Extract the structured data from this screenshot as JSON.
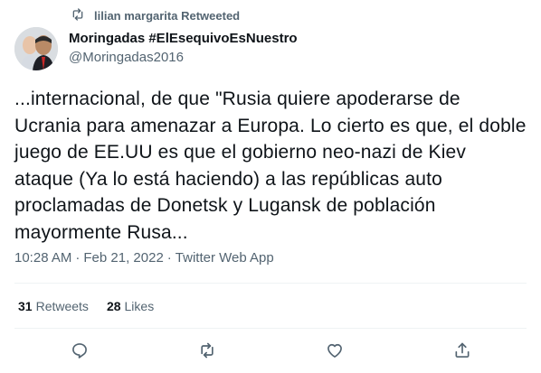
{
  "retweet_notice": "lilian margarita Retweeted",
  "author": {
    "name": "Moringadas #ElEsequivoEsNuestro",
    "handle": "@Moringadas2016"
  },
  "tweet": {
    "text": "...internacional, de que \"Rusia quiere apoderarse de Ucrania para amenazar a Europa. Lo cierto es que, el doble juego de EE.UU es que el gobierno neo-nazi de Kiev ataque (Ya lo está haciendo) a las repúblicas auto proclamadas de Donetsk y Lugansk de población mayormente Rusa..."
  },
  "meta": {
    "time": "10:28 AM",
    "separator": "·",
    "date": "Feb 21, 2022",
    "source": "Twitter Web App"
  },
  "stats": {
    "retweets_count": "31",
    "retweets_label": "Retweets",
    "likes_count": "28",
    "likes_label": "Likes"
  },
  "icons": {
    "retweet_notice": "retweet-icon",
    "reply": "reply-icon",
    "retweet": "retweet-icon",
    "like": "heart-icon",
    "share": "share-icon"
  },
  "colors": {
    "text_primary": "#0f1419",
    "text_secondary": "#536471",
    "divider": "#eff3f4"
  }
}
